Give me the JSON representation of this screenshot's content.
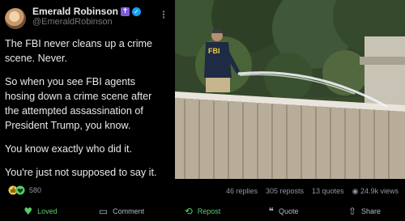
{
  "author": {
    "name": "Emerald Robinson",
    "handle": "@EmeraldRobinson",
    "badge_cross": "✝",
    "verified_mark": "✓"
  },
  "post": {
    "paragraphs": [
      "The FBI never cleans up a crime scene. Never.",
      "So when you see FBI agents hosing down a crime scene after the attempted assassination of President Trump, you know.",
      "You know exactly who did it.",
      "You're just not supposed to say it."
    ]
  },
  "photo": {
    "vest_text": "FBI"
  },
  "engagement": {
    "reactions_count": "580",
    "replies": "46 replies",
    "reposts": "305 reposts",
    "quotes": "13 quotes",
    "views": "24.9k views"
  },
  "actions": {
    "loved": "Loved",
    "comment": "Comment",
    "repost": "Repost",
    "quote": "Quote",
    "share": "Share"
  },
  "colors": {
    "background": "#000000",
    "text": "#e7e9ea",
    "muted": "#8b98a5",
    "accent_green": "#5acc68",
    "verified_blue": "#1d9bf0"
  },
  "icons": {
    "avatar": "avatar",
    "verified": "verified-icon",
    "menu": "ellipsis-icon",
    "reaction": "thumbs-up-heart-icon",
    "views": "eye-icon",
    "loved": "heart-icon",
    "comment": "comment-icon",
    "repost": "repost-icon",
    "quote": "quote-icon",
    "share": "share-icon"
  }
}
